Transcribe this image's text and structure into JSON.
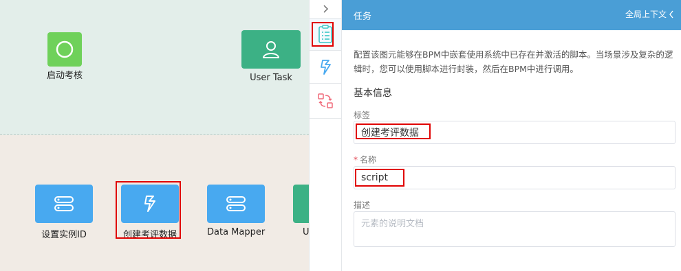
{
  "canvas": {
    "nodes": [
      {
        "label": "启动考核",
        "icon": "circle-icon"
      },
      {
        "label": "User Task",
        "icon": "user-icon"
      },
      {
        "label": "设置实例ID",
        "icon": "list-icon"
      },
      {
        "label": "创建考评数据",
        "icon": "script-icon"
      },
      {
        "label": "Data Mapper",
        "icon": "list-icon"
      },
      {
        "label": "U",
        "icon": "user-icon"
      }
    ]
  },
  "tabs": {
    "collapse_icon": "chevron-right-icon",
    "items": [
      {
        "icon": "checklist-icon",
        "color": "#3cc6c6"
      },
      {
        "icon": "script-icon",
        "color": "#48a9f0"
      },
      {
        "icon": "swap-icon",
        "color": "#f06a7a"
      }
    ]
  },
  "panel": {
    "title": "任务",
    "context_label": "全局上下文",
    "context_icon": "chevron-left-icon",
    "description": "配置该图元能够在BPM中嵌套使用系统中已存在并激活的脚本。当场景涉及复杂的逻辑时，您可以使用脚本进行封装，然后在BPM中进行调用。",
    "section_title": "基本信息",
    "fields": {
      "label": {
        "label": "标签",
        "value": "创建考评数据"
      },
      "name": {
        "label": "名称",
        "required_mark": "*",
        "value": "script"
      },
      "description": {
        "label": "描述",
        "placeholder": "元素的说明文档"
      }
    }
  },
  "colors": {
    "header": "#4a9ed6",
    "start_node": "#6fd15a",
    "user_task": "#3cb185",
    "service_node": "#48a9f0",
    "highlight": "#e00000"
  }
}
